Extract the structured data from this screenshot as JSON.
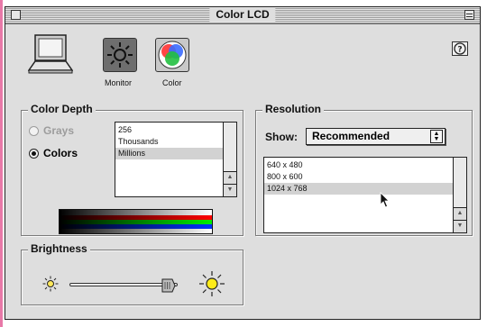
{
  "window": {
    "title": "Color LCD"
  },
  "toolbar": {
    "items": [
      {
        "label": "Monitor",
        "icon": "sun-icon"
      },
      {
        "label": "Color",
        "icon": "rgb-circles-icon"
      }
    ],
    "help_icon": "question-mark-icon"
  },
  "color_depth": {
    "title": "Color Depth",
    "grays_label": "Grays",
    "colors_label": "Colors",
    "selected": "Colors",
    "depths": [
      "256",
      "Thousands",
      "Millions"
    ],
    "selected_depth": "Millions"
  },
  "resolution": {
    "title": "Resolution",
    "show_label": "Show:",
    "show_value": "Recommended",
    "modes": [
      "640 x 480",
      "800 x 600",
      "1024 x 768"
    ],
    "selected_mode": "1024 x 768"
  },
  "brightness": {
    "title": "Brightness",
    "level": 0.92
  },
  "colors": {
    "window_bg": "#dedede",
    "selection": "#d2d2d2",
    "accent_pink": "#e879a8"
  }
}
